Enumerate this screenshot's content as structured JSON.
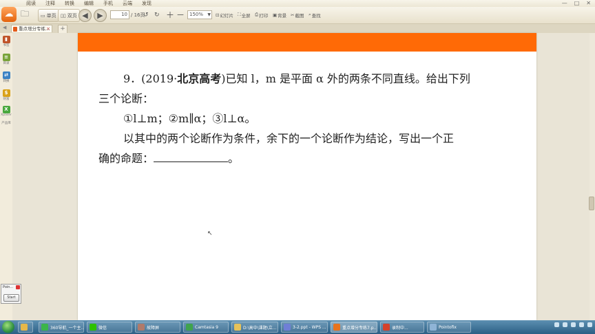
{
  "menu": {
    "tabs": [
      "阅读",
      "注释",
      "转换",
      "编辑",
      "手机",
      "云端",
      "发现"
    ]
  },
  "toolbar": {
    "single_page_label": "单页",
    "double_page_label": "双页",
    "current_page": "10",
    "total_pages": "/ 16页",
    "zoom": "150%",
    "fit_label": "幻灯片",
    "fullscreen_label": "全屏",
    "print_label": "打印",
    "background_label": "背景",
    "screenshot_label": "截图",
    "search_label": "查找"
  },
  "tabs": {
    "active_label": "重点增分专练..."
  },
  "sidebar": {
    "items": [
      "书签",
      "目录",
      "转换",
      "财富",
      "Xpaser",
      "产品库"
    ]
  },
  "document": {
    "q_number": "9．(2019·",
    "q_source": "北京高考",
    "line1_rest": ")已知 l，m 是平面 α 外的两条不同直线。给出下列",
    "line2": "三个论断：",
    "line3": "①l⊥m；②m∥α；③l⊥α。",
    "line4": "以其中的两个论断作为条件，余下的一个论断作为结论，写出一个正",
    "line5_prefix": "确的命题：",
    "line5_suffix": "。"
  },
  "widget": {
    "title": "Poin...",
    "start_label": "Start"
  },
  "taskbar": {
    "apps": [
      "360导航_一个主...",
      "微信",
      "故障屏",
      "Camtasia 9",
      "D:\\高中\\课题\\立...",
      "3-2.ppt - WPS ...",
      "重点增分专练7.p...",
      "录制中...",
      "Pointofix"
    ]
  }
}
